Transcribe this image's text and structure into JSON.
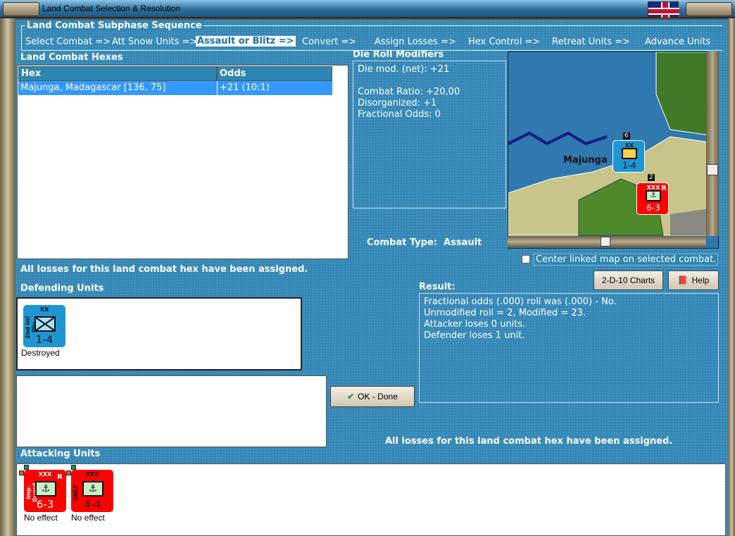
{
  "window": {
    "title": "Land Combat Selection & Resolution"
  },
  "sequence": {
    "title": "Land Combat Subphase Sequence",
    "steps": [
      "Select Combat =>",
      "Att Snow Units =>",
      "Assault or Blitz =>",
      "Convert =>",
      "Assign Losses =>",
      "Hex Control =>",
      "Retreat Units =>",
      "Advance Units"
    ],
    "active_index": 2
  },
  "hexes": {
    "title": "Land Combat Hexes",
    "columns": [
      "Hex",
      "Odds"
    ],
    "rows": [
      {
        "hex": "Majunga, Madagascar [136, 75]",
        "odds": "+21 (10:1)"
      }
    ]
  },
  "modifiers": {
    "title": "Die Roll Modifiers",
    "lines": [
      "Die mod. (net): +21",
      "",
      "Combat Ratio: +20,00",
      "Disorganized: +1",
      "Fractional Odds: 0"
    ]
  },
  "map": {
    "city_label": "Majunga",
    "stack_count_top": "6",
    "stack_count_bottom": "2",
    "defender": {
      "size": "XX",
      "name": "2nd Inf Div",
      "strength": "1-4"
    },
    "attacker": {
      "size": "XXX",
      "name": "Imp. Guard",
      "strength": "6-3",
      "reserve": "R"
    }
  },
  "center_checkbox": {
    "label": "Center linked map on selected combat.",
    "checked": false
  },
  "combat_type": {
    "label": "Combat Type:",
    "value": "Assault"
  },
  "losses_msg": "All losses for this land combat hex have been assigned.",
  "buttons": {
    "charts": "2-D-10 Charts",
    "help": "Help",
    "ok": "OK - Done"
  },
  "defending": {
    "title": "Defending Units",
    "units": [
      {
        "name": "2nd Inf Div",
        "size": "XX",
        "strength": "1-4",
        "status": "Destroyed"
      }
    ]
  },
  "result": {
    "title": "Result:",
    "lines": [
      "Fractional odds (.000) roll was (.000)  - No.",
      "Unmodified roll = 2, Modified = 23.",
      "Attacker loses 0 units.",
      "Defender loses 1 unit."
    ]
  },
  "attacking": {
    "title": "Attacking Units",
    "units": [
      {
        "name": "Imp. Guard",
        "size": "XXX",
        "strength": "6-3",
        "reserve": "R",
        "status": "No effect"
      },
      {
        "name": "SNLF",
        "size": "XXX",
        "strength": "4-4",
        "reserve": "",
        "status": "No effect"
      }
    ]
  },
  "colors": {
    "panel": "#3587b5",
    "selected_row": "#3399ff",
    "defender": "#1e96d2",
    "attacker": "#ff0000"
  }
}
